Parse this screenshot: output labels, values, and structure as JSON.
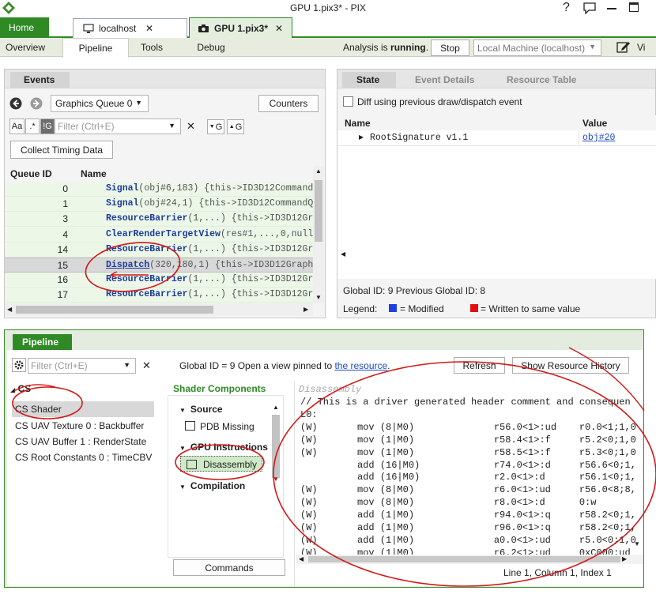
{
  "window": {
    "title": "GPU 1.pix3* - PIX",
    "help": "?",
    "feedback": "feedback",
    "minimize": "—",
    "maximize": "☐"
  },
  "tabs": {
    "home": "Home",
    "localhost": "localhost",
    "gpu": "GPU 1.pix3*",
    "close": "✕"
  },
  "menu": {
    "overview": "Overview",
    "pipeline": "Pipeline",
    "tools": "Tools",
    "debug": "Debug",
    "analysis_prefix": "Analysis is ",
    "analysis_state": "running",
    "analysis_suffix": ".",
    "stop": "Stop",
    "machine": "Local Machine (localhost)",
    "view": "Vi"
  },
  "events": {
    "tab": "Events",
    "queue": "Graphics Queue 0",
    "counters": "Counters",
    "aa": "Aa",
    "regex": ".*",
    "group": "!G",
    "filter_placeholder": "Filter (Ctrl+E)",
    "clear": "✕",
    "prev_g": "G",
    "next_g": "G",
    "collect": "Collect Timing Data",
    "col_id": "Queue ID",
    "col_name": "Name",
    "rows": [
      {
        "id": "0",
        "fn": "Signal",
        "args": "(obj#6,183)  {this->ID3D12CommandQ"
      },
      {
        "id": "1",
        "fn": "Signal",
        "args": "(obj#24,1)  {this->ID3D12CommandQ"
      },
      {
        "id": "3",
        "fn": "ResourceBarrier",
        "args": "(1,...)  {this->ID3D12Gr"
      },
      {
        "id": "4",
        "fn": "ClearRenderTargetView",
        "args": "(res#1,...,0,nullp"
      },
      {
        "id": "14",
        "fn": "ResourceBarrier",
        "args": "(1,...)  {this->ID3D12Gr"
      },
      {
        "id": "15",
        "fn": "Dispatch",
        "args": "(320,180,1)  {this->ID3D12Graph"
      },
      {
        "id": "16",
        "fn": "ResourceBarrier",
        "args": "(1,...)  {this->ID3D12Gr"
      },
      {
        "id": "17",
        "fn": "ResourceBarrier",
        "args": "(1,...)  {this->ID3D12Gr"
      }
    ]
  },
  "state": {
    "tab_state": "State",
    "tab_details": "Event Details",
    "tab_resources": "Resource Table",
    "diff": "Diff using previous draw/dispatch event",
    "col_name": "Name",
    "col_value": "Value",
    "root_sig": "RootSignature v1.1",
    "root_val": "obj#20",
    "global_ids": "Global ID: 9  Previous Global ID: 8",
    "legend": "Legend:",
    "modified": "= Modified",
    "written": "= Written to same value",
    "modified_color": "#1f3fe0",
    "written_color": "#e01010"
  },
  "pipeline": {
    "tab": "Pipeline",
    "filter_placeholder": "Filter (Ctrl+E)",
    "clear": "✕",
    "global_text": "Global ID = 9   Open a view pinned to ",
    "resource_link": "the resource",
    "global_end": ".",
    "refresh": "Refresh",
    "history": "Show Resource History",
    "stage": "CS",
    "stage_items": [
      "CS Shader",
      "CS UAV Texture 0 : Backbuffer",
      "CS UAV Buffer 1 : RenderState",
      "CS Root Constants 0 : TimeCBV"
    ],
    "components_title": "Shader Components",
    "source": "Source",
    "pdb": "PDB Missing",
    "gpu_instr": "GPU Instructions",
    "disassembly": "Disassembly",
    "compilation": "Compilation",
    "commands": "Commands",
    "dis_title": "Disassembly",
    "dis_lines": [
      "// This is a driver generated header comment and consequen",
      "L0:",
      "(W)       mov (8|M0)              r56.0<1>:ud    r0.0<1;1,0",
      "(W)       mov (1|M0)              r58.4<1>:f     r5.2<0;1,0",
      "(W)       mov (1|M0)              r58.5<1>:f     r5.3<0;1,0",
      "          add (16|M0)             r74.0<1>:d     r56.6<0;1,",
      "          add (16|M0)             r2.0<1>:d      r56.1<0;1,",
      "(W)       mov (8|M0)              r6.0<1>:ud     r56.0<8;8,",
      "(W)       mov (8|M0)              r8.0<1>:d      0:w",
      "(W)       add (1|M0)              r94.0<1>:q     r58.2<0;1,",
      "(W)       add (1|M0)              r96.0<1>:q     r58.2<0;1,",
      "(W)       add (1|M0)              a0.0<1>:ud     r5.0<0;1,0",
      "(W)       mov (1|M0)              r6.2<1>:ud     0xC000:ud"
    ],
    "status": "Line 1, Column 1, Index 1"
  }
}
